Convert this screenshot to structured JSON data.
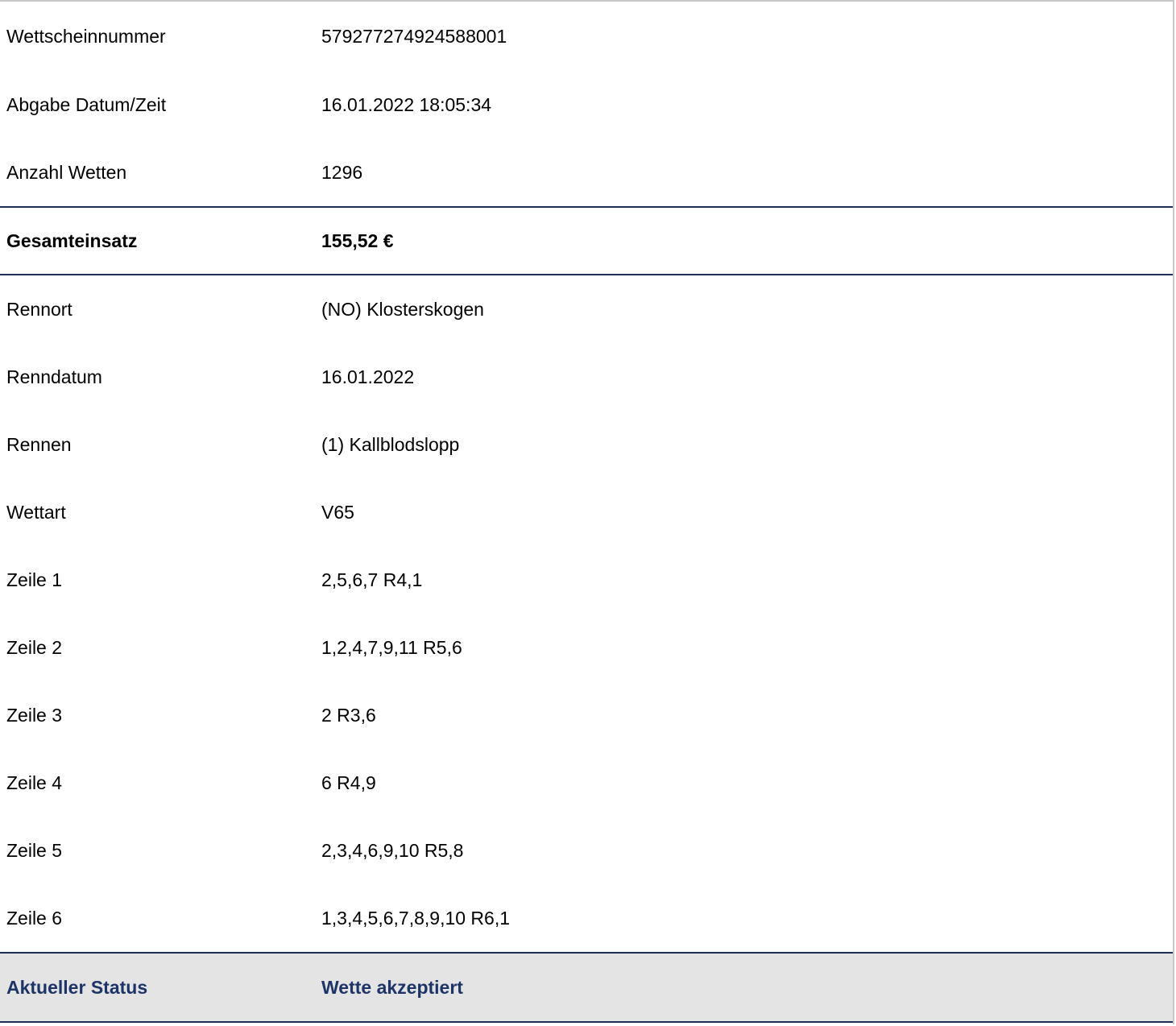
{
  "ticket": {
    "number_label": "Wettscheinnummer",
    "number_value": "579277274924588001",
    "submitted_label": "Abgabe Datum/Zeit",
    "submitted_value": "16.01.2022 18:05:34",
    "bet_count_label": "Anzahl Wetten",
    "bet_count_value": "1296"
  },
  "total": {
    "label": "Gesamteinsatz",
    "value": "155,52 €"
  },
  "race": {
    "venue_label": "Rennort",
    "venue_value": "(NO) Klosterskogen",
    "date_label": "Renndatum",
    "date_value": "16.01.2022",
    "race_label": "Rennen",
    "race_value": "(1) Kallblodslopp",
    "bet_type_label": "Wettart",
    "bet_type_value": "V65"
  },
  "lines": [
    {
      "label": "Zeile 1",
      "value": "2,5,6,7 R4,1"
    },
    {
      "label": "Zeile 2",
      "value": "1,2,4,7,9,11 R5,6"
    },
    {
      "label": "Zeile 3",
      "value": "2 R3,6"
    },
    {
      "label": "Zeile 4",
      "value": "6 R4,9"
    },
    {
      "label": "Zeile 5",
      "value": "2,3,4,6,9,10 R5,8"
    },
    {
      "label": "Zeile 6",
      "value": "1,3,4,5,6,7,8,9,10 R6,1"
    }
  ],
  "status": {
    "label": "Aktueller Status",
    "value": "Wette akzeptiert"
  },
  "colors": {
    "divider": "#1e2f57",
    "status_text": "#1d3467",
    "status_background": "#e4e4e4"
  }
}
